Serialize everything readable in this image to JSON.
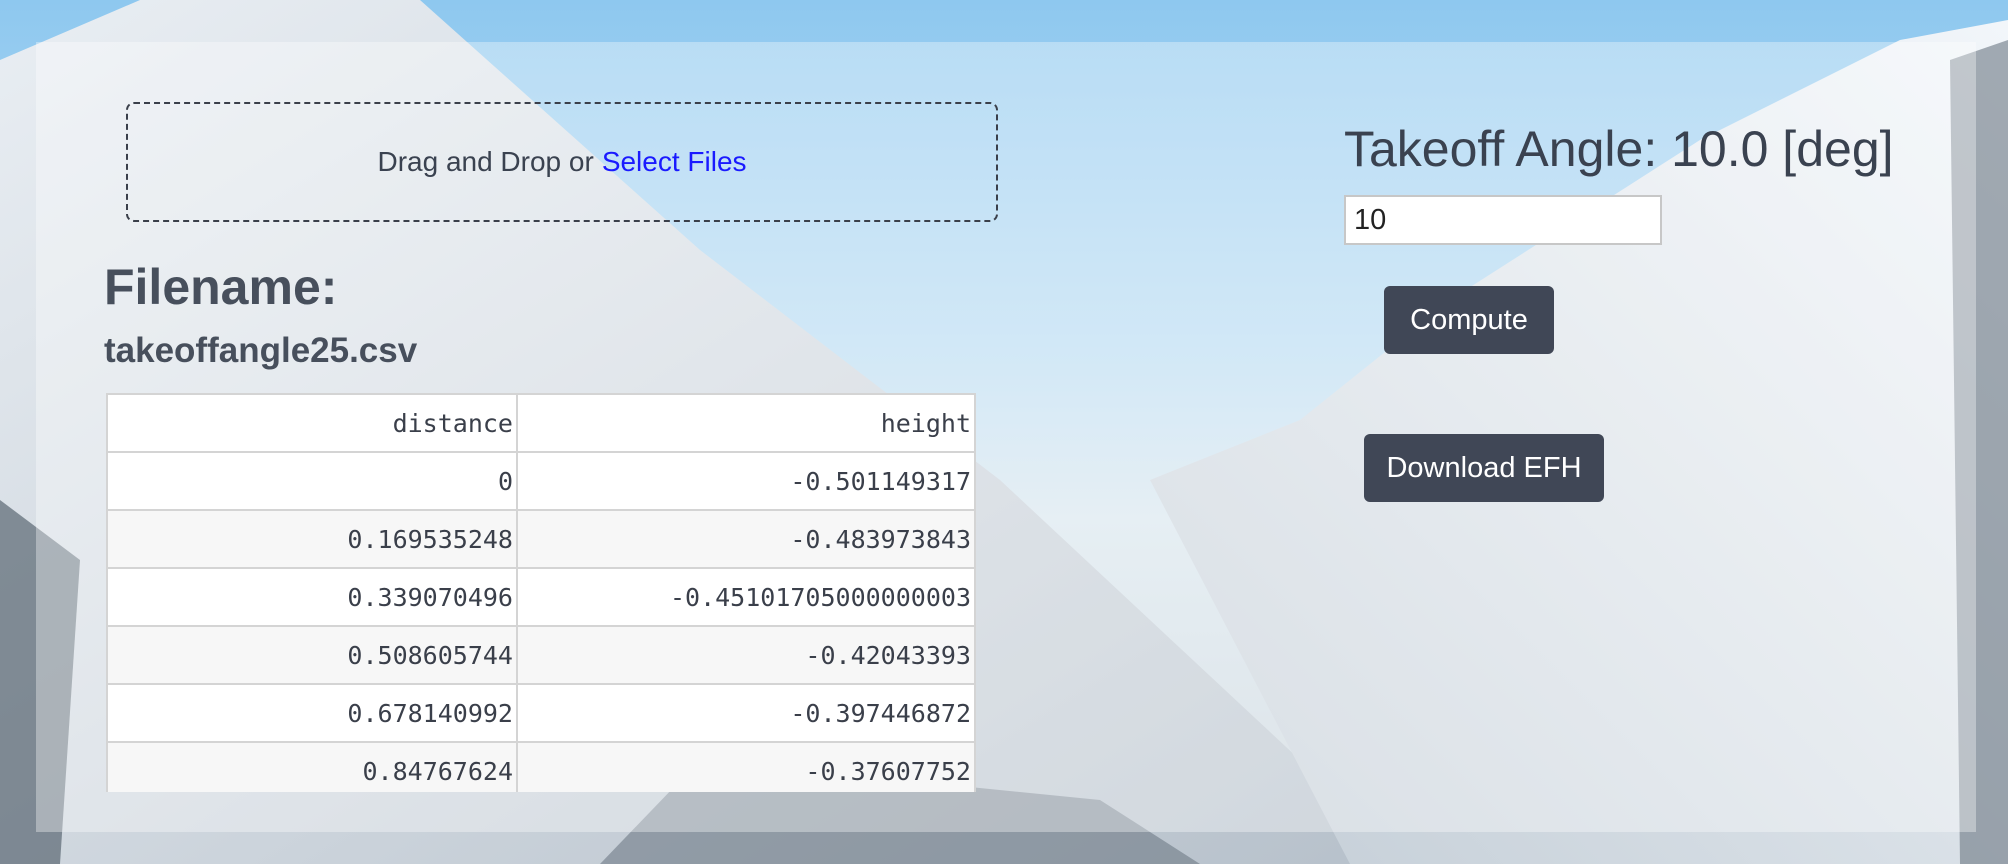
{
  "upload": {
    "prompt": "Drag and Drop or",
    "link": "Select Files"
  },
  "file": {
    "label": "Filename:",
    "name": "takeoffangle25.csv"
  },
  "table": {
    "headers": [
      "distance",
      "height"
    ],
    "rows": [
      [
        "0",
        "-0.501149317"
      ],
      [
        "0.169535248",
        "-0.483973843"
      ],
      [
        "0.339070496",
        "-0.45101705000000003"
      ],
      [
        "0.508605744",
        "-0.42043393"
      ],
      [
        "0.678140992",
        "-0.397446872"
      ],
      [
        "0.84767624",
        "-0.37607752"
      ]
    ]
  },
  "angle": {
    "title": "Takeoff Angle: 10.0 [deg]",
    "input_value": "10"
  },
  "buttons": {
    "compute": "Compute",
    "download": "Download EFH"
  },
  "colors": {
    "button_bg": "#404756",
    "link": "#1a1aff"
  }
}
